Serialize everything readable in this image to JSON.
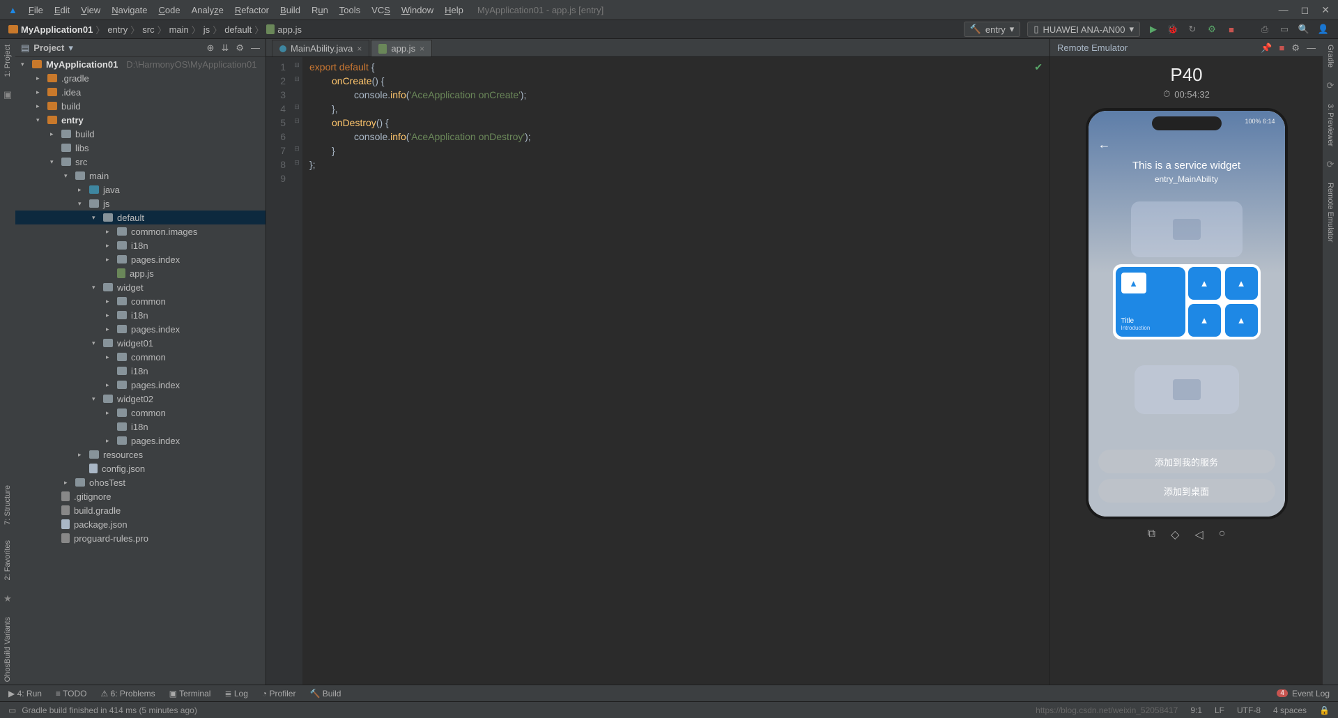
{
  "window": {
    "title": "MyApplication01 - app.js [entry]"
  },
  "menu": [
    "File",
    "Edit",
    "View",
    "Navigate",
    "Code",
    "Analyze",
    "Refactor",
    "Build",
    "Run",
    "Tools",
    "VCS",
    "Window",
    "Help"
  ],
  "breadcrumb": [
    "MyApplication01",
    "entry",
    "src",
    "main",
    "js",
    "default",
    "app.js"
  ],
  "run_config": "entry",
  "device_selector": "HUAWEI ANA-AN00",
  "project_pane": {
    "title": "Project"
  },
  "tree": {
    "root": "MyApplication01",
    "root_path": "D:\\HarmonyOS\\MyApplication01",
    "n_gradle": ".gradle",
    "n_idea": ".idea",
    "n_build": "build",
    "n_entry": "entry",
    "n_entry_build": "build",
    "n_libs": "libs",
    "n_src": "src",
    "n_main": "main",
    "n_java": "java",
    "n_js": "js",
    "n_default": "default",
    "n_common_images": "common.images",
    "n_i18n": "i18n",
    "n_pages_index": "pages.index",
    "n_appjs": "app.js",
    "n_widget": "widget",
    "n_common": "common",
    "n_widget01": "widget01",
    "n_widget02": "widget02",
    "n_resources": "resources",
    "n_configjson": "config.json",
    "n_ohostest": "ohosTest",
    "n_gitignore": ".gitignore",
    "n_buildgradle": "build.gradle",
    "n_package": "package.json",
    "n_proguard": "proguard-rules.pro"
  },
  "tabs": [
    {
      "label": "MainAbility.java",
      "active": false
    },
    {
      "label": "app.js",
      "active": true
    }
  ],
  "code": {
    "l1a": "export default ",
    "l1b": "{",
    "l2a": "onCreate",
    "l2b": "() {",
    "l3a": "console.",
    "l3b": "info",
    "l3c": "(",
    "l3d": "'AceApplication onCreate'",
    "l3e": ");",
    "l4": "},",
    "l5a": "onDestroy",
    "l5b": "() {",
    "l6a": "console.",
    "l6b": "info",
    "l6c": "(",
    "l6d": "'AceApplication onDestroy'",
    "l6e": ");",
    "l7": "}",
    "l8": "};"
  },
  "emulator": {
    "title": "Remote Emulator",
    "device": "P40",
    "timer": "00:54:32",
    "status_right": "100%  6:14",
    "widget_title": "This is a service widget",
    "widget_sub": "entry_MainAbility",
    "card_title": "Title",
    "card_intro": "Introduction",
    "btn1": "添加到我的服务",
    "btn2": "添加到桌面"
  },
  "left_tabs": {
    "project": "1: Project",
    "fav": "2: Favorites",
    "struct": "7: Structure",
    "ohos": "OhosBuild Variants"
  },
  "right_tabs": {
    "gradle": "Gradle",
    "preview": "3: Previewer",
    "remote": "Remote Emulator"
  },
  "bottom": {
    "run": "4: Run",
    "todo": "TODO",
    "problems": "6: Problems",
    "terminal": "Terminal",
    "log": "Log",
    "profiler": "Profiler",
    "build": "Build",
    "eventlog": "Event Log",
    "event_count": "4"
  },
  "status": {
    "msg": "Gradle build finished in 414 ms (5 minutes ago)",
    "pos": "9:1",
    "encoding": "LF",
    "charset": "UTF-8",
    "indent": "4 spaces",
    "watermark": "https://blog.csdn.net/weixin_52058417"
  }
}
